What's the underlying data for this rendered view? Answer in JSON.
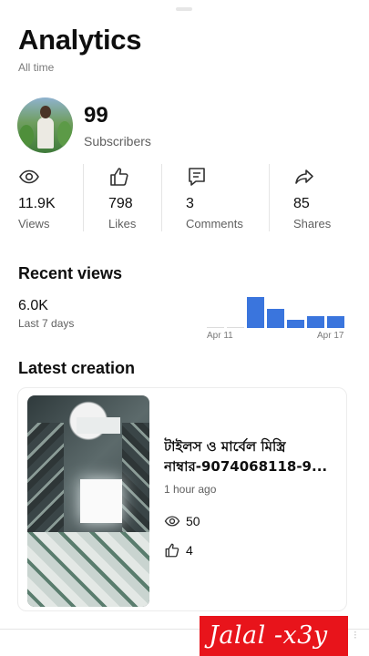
{
  "header": {
    "title": "Analytics",
    "period": "All time"
  },
  "channel": {
    "subscribers_value": "99",
    "subscribers_label": "Subscribers",
    "avatar_icon": "profile-photo"
  },
  "stats": [
    {
      "icon": "eye-icon",
      "value": "11.9K",
      "label": "Views"
    },
    {
      "icon": "thumbs-up-icon",
      "value": "798",
      "label": "Likes"
    },
    {
      "icon": "comment-icon",
      "value": "3",
      "label": "Comments"
    },
    {
      "icon": "share-icon",
      "value": "85",
      "label": "Shares"
    }
  ],
  "recent_views": {
    "heading": "Recent views",
    "value": "6.0K",
    "period": "Last 7 days",
    "start_label": "Apr 11",
    "end_label": "Apr 17",
    "accent": "#3a75dd",
    "daily_share": [
      0,
      0,
      1.0,
      0.63,
      0.25,
      0.37,
      0.37
    ]
  },
  "latest_creation": {
    "heading": "Latest creation",
    "title_line1": "টাইলস ও মার্বেল মিস্ত্রি",
    "title_line2": "নাম্বার-9074068118-9...",
    "age": "1 hour ago",
    "views": "50",
    "likes": "4"
  },
  "watermark": {
    "text": "Jalal -x3y",
    "color": "#e8141b"
  }
}
